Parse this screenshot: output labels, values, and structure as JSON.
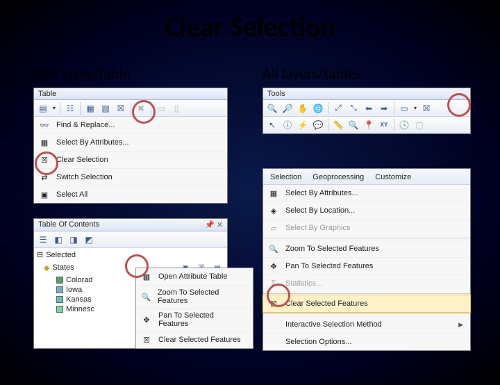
{
  "slide": {
    "title": "Clear Selection",
    "left_heading": "One layer/table",
    "right_heading": "All layers/tables"
  },
  "table_panel": {
    "title": "Table",
    "menu": [
      {
        "icon": "binoculars",
        "label": "Find & Replace..."
      },
      {
        "icon": "select-attr",
        "label": "Select By Attributes..."
      },
      {
        "icon": "clear-sel",
        "label": "Clear Selection"
      },
      {
        "icon": "switch-sel",
        "label": "Switch Selection"
      },
      {
        "icon": "select-all",
        "label": "Select All"
      }
    ],
    "toolbar_icons": [
      "table-menu",
      "related",
      "attr",
      "export",
      "clear-sel",
      "delete",
      "select-col",
      "select-row"
    ]
  },
  "toc_panel": {
    "title": "Table Of Contents",
    "selected_label": "Selected",
    "layer": "States",
    "items": [
      {
        "color": "#4fa36a",
        "label": "Colorad"
      },
      {
        "color": "#6fb2d6",
        "label": "Iowa"
      },
      {
        "color": "#5fc4c0",
        "label": "Kansas"
      },
      {
        "color": "#7bd0a8",
        "label": "Minnesc"
      }
    ],
    "context": [
      {
        "icon": "table",
        "label": "Open Attribute Table"
      },
      {
        "icon": "zoom-sel",
        "label": "Zoom To Selected Features"
      },
      {
        "icon": "pan-sel",
        "label": "Pan To Selected Features"
      },
      {
        "icon": "clear-sel",
        "label": "Clear Selected Features"
      }
    ],
    "row_icons": [
      "sel1",
      "sel2",
      "sel3"
    ]
  },
  "tools_panel": {
    "title": "Tools",
    "row1": [
      "zoom-in",
      "zoom-out",
      "pan",
      "globe",
      "prev",
      "next",
      "zoom-box",
      "zoom-full",
      "toggle",
      "clear-sel"
    ],
    "row2": [
      "pointer",
      "identify",
      "hyperlink",
      "html",
      "measure",
      "find",
      "goto",
      "xy",
      "time",
      "clear"
    ]
  },
  "selection_menu": {
    "tabs": [
      "Selection",
      "Geoprocessing",
      "Customize"
    ],
    "items": [
      {
        "icon": "sel-attr",
        "label": "Select By Attributes..."
      },
      {
        "icon": "sel-loc",
        "label": "Select By Location..."
      },
      {
        "icon": "sel-graph",
        "label": "Select By Graphics",
        "disabled": true
      },
      {
        "icon": "zoom-sel",
        "label": "Zoom To Selected Features"
      },
      {
        "icon": "pan-sel",
        "label": "Pan To Selected Features"
      },
      {
        "icon": "stats",
        "label": "Statistics...",
        "disabled": true
      },
      {
        "icon": "clear-sel",
        "label": "Clear Selected Features",
        "highlight": true
      },
      {
        "icon": "int-sel",
        "label": "Interactive Selection Method",
        "submenu": true
      },
      {
        "icon": "opts",
        "label": "Selection Options..."
      }
    ]
  }
}
